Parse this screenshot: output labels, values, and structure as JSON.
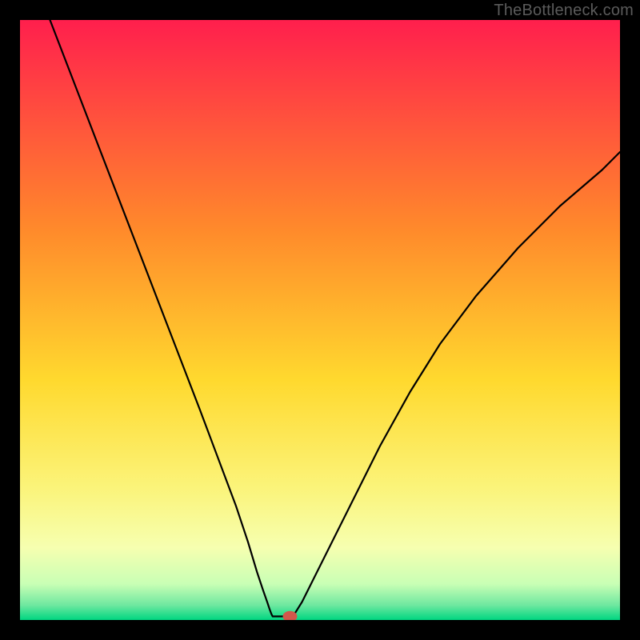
{
  "watermark": "TheBottleneck.com",
  "chart_data": {
    "type": "line",
    "title": "",
    "xlabel": "",
    "ylabel": "",
    "xlim": [
      0,
      100
    ],
    "ylim": [
      0,
      100
    ],
    "grid": false,
    "legend": false,
    "background_gradient_stops": [
      {
        "offset": 0.0,
        "color": "#ff1f4d"
      },
      {
        "offset": 0.35,
        "color": "#ff8a2b"
      },
      {
        "offset": 0.6,
        "color": "#ffd92e"
      },
      {
        "offset": 0.78,
        "color": "#fbf47a"
      },
      {
        "offset": 0.88,
        "color": "#f6ffb0"
      },
      {
        "offset": 0.94,
        "color": "#c9ffb5"
      },
      {
        "offset": 0.975,
        "color": "#6fe8a0"
      },
      {
        "offset": 1.0,
        "color": "#00d681"
      }
    ],
    "series": [
      {
        "name": "left-branch",
        "x": [
          5,
          10,
          15,
          20,
          25,
          30,
          33,
          36,
          38,
          39.5,
          40.5,
          41.2,
          41.6,
          41.9,
          42.1
        ],
        "y": [
          100,
          87,
          74,
          61,
          48,
          35,
          27,
          19,
          13,
          8,
          5,
          3,
          1.8,
          1,
          0.6
        ]
      },
      {
        "name": "flat-minimum",
        "x": [
          42.1,
          44.0,
          45.5
        ],
        "y": [
          0.6,
          0.6,
          0.6
        ]
      },
      {
        "name": "right-branch",
        "x": [
          45.5,
          47,
          49,
          52,
          56,
          60,
          65,
          70,
          76,
          83,
          90,
          97,
          100
        ],
        "y": [
          0.6,
          3,
          7,
          13,
          21,
          29,
          38,
          46,
          54,
          62,
          69,
          75,
          78
        ]
      }
    ],
    "marker": {
      "name": "bottleneck-marker",
      "x": 45.0,
      "y": 0.6,
      "rx": 1.2,
      "ry": 0.9,
      "color": "#d1574b"
    }
  }
}
